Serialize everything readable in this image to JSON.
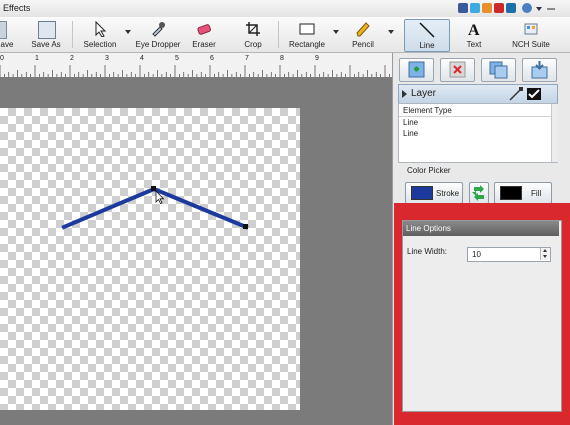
{
  "menubar": {
    "label": "Effects"
  },
  "toolbar": {
    "items": [
      {
        "label": "ave"
      },
      {
        "label": "Save As"
      },
      {
        "label": "Selection"
      },
      {
        "label": "Eye Dropper"
      },
      {
        "label": "Eraser"
      },
      {
        "label": "Crop"
      },
      {
        "label": "Rectangle"
      },
      {
        "label": "Pencil"
      },
      {
        "label": "Line"
      },
      {
        "label": "Text"
      },
      {
        "label": "NCH Suite"
      }
    ],
    "selected": "Line"
  },
  "ruler": {
    "labels": [
      "0",
      "1",
      "2",
      "3",
      "4",
      "5",
      "6",
      "7",
      "8",
      "9"
    ]
  },
  "layer_panel": {
    "title": "Layer",
    "column_header": "Element Type",
    "rows": [
      "Line",
      "Line"
    ]
  },
  "color_picker": {
    "title": "Color Picker",
    "stroke_label": "Stroke",
    "fill_label": "Fill",
    "stroke_color": "#1c3a9e",
    "fill_color": "#000000"
  },
  "line_options": {
    "title": "Line Options",
    "width_label": "Line Width:",
    "width_value": "10"
  },
  "colors": {
    "highlight": "#d9282e",
    "line": "#1c3a9e"
  },
  "icons": [
    "facebook-icon",
    "twitter-icon",
    "rss-icon",
    "youtube-icon",
    "linkedin-icon",
    "help-icon"
  ]
}
